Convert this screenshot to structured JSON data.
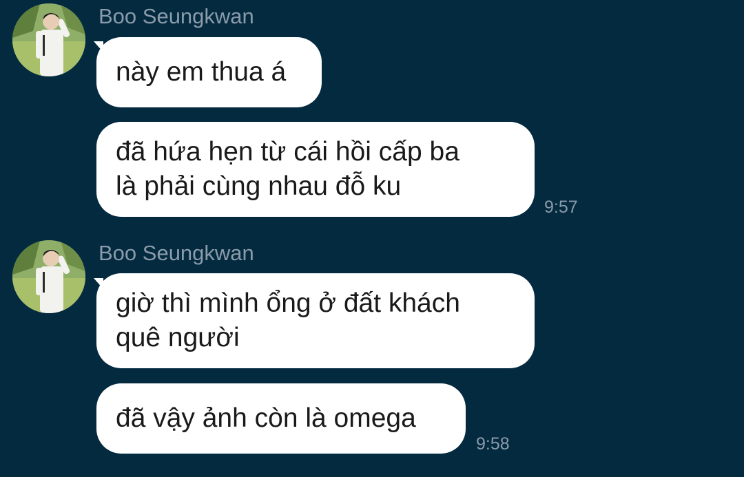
{
  "colors": {
    "background": "#042a40",
    "bubble": "#ffffff",
    "meta_text": "#8a9ba9",
    "message_text": "#1a1a1a"
  },
  "groups": [
    {
      "sender": "Boo Seungkwan",
      "avatar": "profile-photo",
      "messages": [
        {
          "text": "này em thua á"
        },
        {
          "text": "đã hứa hẹn từ cái hồi cấp ba\nlà phải cùng nhau đỗ ku",
          "time": "9:57"
        }
      ]
    },
    {
      "sender": "Boo Seungkwan",
      "avatar": "profile-photo",
      "messages": [
        {
          "text": "giờ thì mình ổng ở đất khách\nquê người"
        },
        {
          "text": "đã vậy ảnh còn là omega",
          "time": "9:58"
        }
      ]
    }
  ]
}
